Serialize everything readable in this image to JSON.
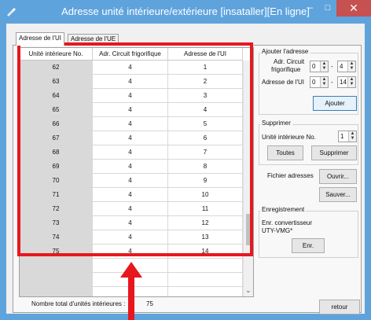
{
  "window": {
    "title": "Adresse unité intérieure/extérieure [insataller][En ligne]",
    "minimize": "–",
    "maximize": "□",
    "close": "✕"
  },
  "tabs": [
    {
      "label": "Adresse de l'UI",
      "active": true
    },
    {
      "label": "Adresse de l'UE",
      "active": false
    }
  ],
  "table": {
    "columns": [
      "Unité intérieure No.",
      "Adr. Circuit frigorifique",
      "Adresse de l'UI"
    ],
    "rows": [
      [
        "62",
        "4",
        "1"
      ],
      [
        "63",
        "4",
        "2"
      ],
      [
        "64",
        "4",
        "3"
      ],
      [
        "65",
        "4",
        "4"
      ],
      [
        "66",
        "4",
        "5"
      ],
      [
        "67",
        "4",
        "6"
      ],
      [
        "68",
        "4",
        "7"
      ],
      [
        "69",
        "4",
        "8"
      ],
      [
        "70",
        "4",
        "9"
      ],
      [
        "71",
        "4",
        "10"
      ],
      [
        "72",
        "4",
        "11"
      ],
      [
        "73",
        "4",
        "12"
      ],
      [
        "74",
        "4",
        "13"
      ],
      [
        "75",
        "4",
        "14"
      ]
    ],
    "total_label": "Nombre total d'unités intérieures :",
    "total_value": "75"
  },
  "add_group": {
    "title": "Ajouter l'adresse",
    "circuit_label_1": "Adr. Circuit",
    "circuit_label_2": "frigorifique",
    "circuit_from": "0",
    "circuit_sep": "-",
    "circuit_to": "4",
    "ui_label": "Adresse de l'UI",
    "ui_from": "0",
    "ui_sep": "-",
    "ui_to": "14",
    "add_button": "Ajouter"
  },
  "delete_group": {
    "title": "Supprimer",
    "unit_label": "Unité intérieure No.",
    "unit_value": "1",
    "all_button": "Toutes",
    "delete_button": "Supprimer"
  },
  "file": {
    "label": "Fichier adresses",
    "open_button": "Ouvrir...",
    "save_button": "Sauver..."
  },
  "record_group": {
    "title": "Enregistrement",
    "desc_1": "Enr. convertisseur",
    "desc_2": "UTY-VMG*",
    "rec_button": "Enr."
  },
  "back_button": "retour",
  "colors": {
    "titlebar": "#5fa3dd",
    "highlight": "#e8171e",
    "close_button": "#c75050"
  }
}
